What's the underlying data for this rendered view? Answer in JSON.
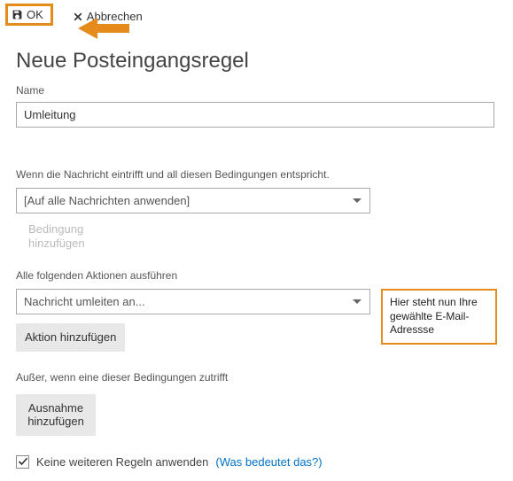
{
  "toolbar": {
    "ok_label": "OK",
    "cancel_label": "Abbrechen"
  },
  "title": "Neue Posteingangsregel",
  "name_section": {
    "label": "Name",
    "value": "Umleitung"
  },
  "conditions": {
    "label": "Wenn die Nachricht eintrifft und all diesen Bedingungen entspricht.",
    "selected": "[Auf alle Nachrichten anwenden]",
    "add_label": "Bedingung hinzufügen"
  },
  "actions": {
    "label": "Alle folgenden Aktionen ausführen",
    "selected": "Nachricht umleiten an...",
    "add_label": "Aktion hinzufügen"
  },
  "exceptions": {
    "label": "Außer, wenn eine dieser Bedingungen zutrifft",
    "add_label": "Ausnahme hinzufügen"
  },
  "stop_rules": {
    "checked": true,
    "label": "Keine weiteren Regeln anwenden",
    "help_text": "(Was bedeutet das?)"
  },
  "annotation": {
    "text": "Hier steht nun Ihre gewählte E-Mail-Adressse"
  },
  "colors": {
    "highlight": "#e58b1c",
    "link": "#0072c6"
  }
}
